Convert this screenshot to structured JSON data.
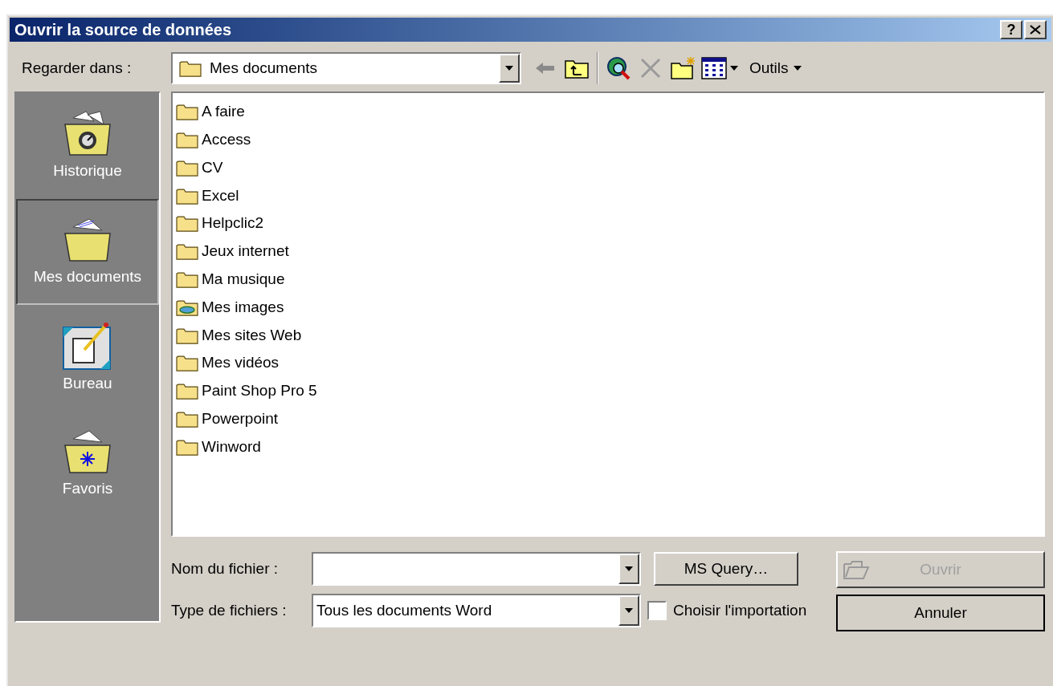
{
  "window": {
    "title": "Ouvrir la source de données",
    "help": "?"
  },
  "look_in": {
    "label": "Regarder dans :",
    "value": "Mes documents"
  },
  "toolbar": {
    "tools": [
      {
        "kind": "back",
        "disabled": true
      },
      {
        "kind": "up",
        "disabled": false
      },
      {
        "kind": "web-search",
        "disabled": false
      },
      {
        "kind": "delete",
        "disabled": true
      },
      {
        "kind": "new-folder",
        "disabled": false
      },
      {
        "kind": "views",
        "disabled": false
      }
    ],
    "tools_menu": "Outils"
  },
  "places": [
    {
      "kind": "history",
      "label": "Historique",
      "selected": false
    },
    {
      "kind": "documents",
      "label": "Mes documents",
      "selected": true
    },
    {
      "kind": "desktop",
      "label": "Bureau",
      "selected": false
    },
    {
      "kind": "favorites",
      "label": "Favoris",
      "selected": false
    }
  ],
  "files": [
    {
      "kind": "folder",
      "name": "A faire"
    },
    {
      "kind": "folder",
      "name": "Access"
    },
    {
      "kind": "folder",
      "name": "CV"
    },
    {
      "kind": "folder",
      "name": "Excel"
    },
    {
      "kind": "folder",
      "name": "Helpclic2"
    },
    {
      "kind": "folder",
      "name": "Jeux internet"
    },
    {
      "kind": "folder",
      "name": "Ma musique"
    },
    {
      "kind": "pictures",
      "name": "Mes images"
    },
    {
      "kind": "folder",
      "name": "Mes sites Web"
    },
    {
      "kind": "folder",
      "name": "Mes vidéos"
    },
    {
      "kind": "folder",
      "name": "Paint Shop Pro 5"
    },
    {
      "kind": "folder",
      "name": "Powerpoint"
    },
    {
      "kind": "folder",
      "name": "Winword"
    }
  ],
  "file_name": {
    "label": "Nom du fichier :"
  },
  "file_type": {
    "label": "Type de fichiers :",
    "value": "Tous les documents Word"
  },
  "import_option": {
    "label": "Choisir l'importation",
    "checked": false
  },
  "buttons": {
    "query": {
      "label": "MS Query…",
      "disabled": false
    },
    "open": {
      "label": "Ouvrir",
      "disabled": true
    },
    "cancel": {
      "label": "Annuler",
      "disabled": false
    }
  }
}
